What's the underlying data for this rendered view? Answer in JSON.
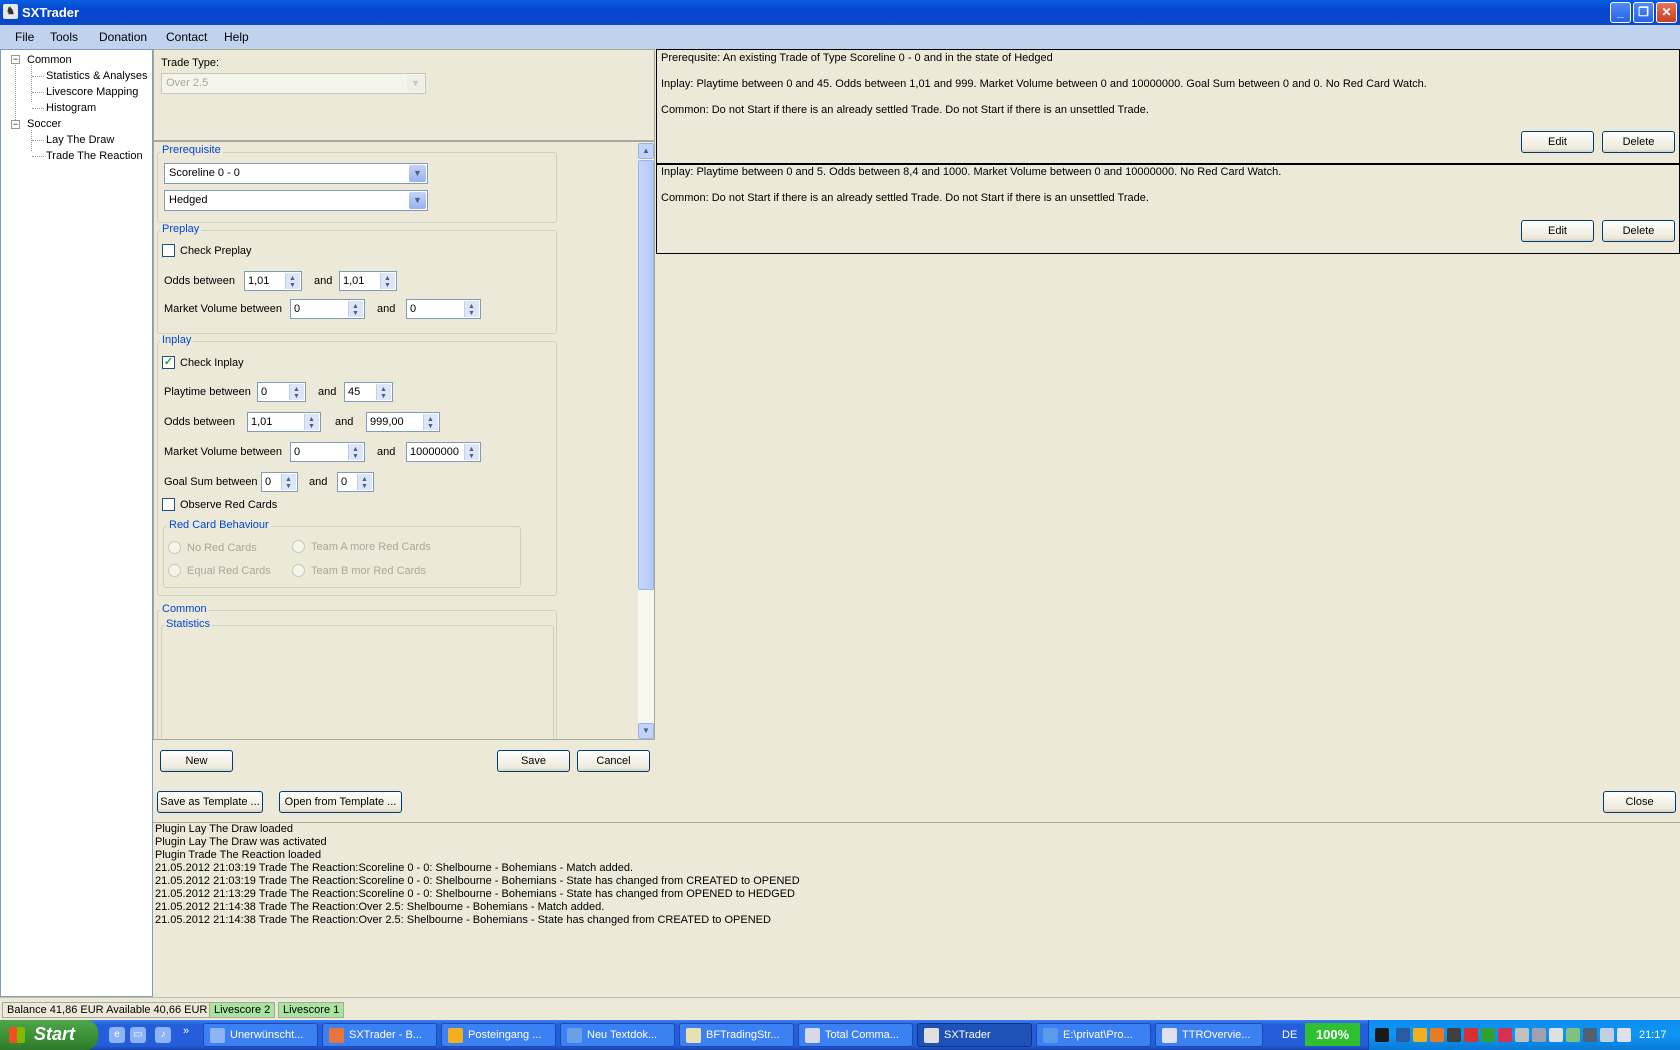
{
  "window": {
    "title": "SXTrader"
  },
  "menu": [
    "File",
    "Tools",
    "Donation",
    "Contact",
    "Help"
  ],
  "tree": {
    "groups": [
      {
        "label": "Common",
        "items": [
          "Statistics & Analyses",
          "Livescore Mapping",
          "Histogram"
        ]
      },
      {
        "label": "Soccer",
        "items": [
          "Lay The Draw",
          "Trade The Reaction"
        ]
      }
    ]
  },
  "form": {
    "trade_type_label": "Trade Type:",
    "trade_type_value": "Over 2.5",
    "prerequisite": {
      "title": "Prerequisite",
      "combo1": "Scoreline 0 - 0",
      "combo2": "Hedged"
    },
    "preplay": {
      "title": "Preplay",
      "check_label": "Check Preplay",
      "checked": false,
      "odds_label": "Odds between",
      "odds_from": "1,01",
      "odds_to": "1,01",
      "and_label": "and",
      "volume_label": "Market Volume between",
      "volume_from": "0",
      "volume_to": "0"
    },
    "inplay": {
      "title": "Inplay",
      "check_label": "Check Inplay",
      "checked": true,
      "playtime_label": "Playtime between",
      "playtime_from": "0",
      "playtime_to": "45",
      "odds_label": "Odds between",
      "odds_from": "1,01",
      "odds_to": "999,00",
      "volume_label": "Market Volume between",
      "volume_from": "0",
      "volume_to": "10000000",
      "goalsum_label": "Goal Sum between",
      "goalsum_from": "0",
      "goalsum_to": "0",
      "and_label": "and",
      "red_cards_label": "Observe Red Cards",
      "red_cards_checked": false,
      "red_card_behaviour": {
        "title": "Red Card Behaviour",
        "options": [
          "No Red Cards",
          "Team A more Red Cards",
          "Equal Red Cards",
          "Team B mor Red Cards"
        ]
      }
    },
    "common": {
      "title": "Common",
      "statistics_title": "Statistics"
    }
  },
  "buttons": {
    "new": "New",
    "save": "Save",
    "cancel": "Cancel",
    "save_template": "Save as Template ...",
    "open_template": "Open from Template ...",
    "close": "Close",
    "edit": "Edit",
    "delete": "Delete"
  },
  "cards": [
    {
      "lines": [
        "Prerequsite: An existing Trade of Type Scoreline 0 - 0 and in the state of Hedged",
        "Inplay: Playtime between 0 and 45. Odds between 1,01 and 999. Market Volume between 0 and 10000000. Goal Sum between 0 and 0. No Red Card Watch.",
        "Common: Do not Start if there is an already settled Trade. Do not Start if there is an unsettled Trade."
      ]
    },
    {
      "lines": [
        "Inplay: Playtime between 0 and 5. Odds between 8,4 and 1000. Market Volume between 0 and 10000000. No Red Card Watch.",
        "Common: Do not Start if there is an already settled Trade. Do not Start if there is an unsettled Trade."
      ]
    }
  ],
  "log": [
    "Plugin Lay The Draw loaded",
    "Plugin Lay The Draw was activated",
    "Plugin Trade The Reaction loaded",
    "21.05.2012 21:03:19 Trade The Reaction:Scoreline 0 - 0: Shelbourne - Bohemians - Match added.",
    "21.05.2012 21:03:19 Trade The Reaction:Scoreline 0 - 0: Shelbourne - Bohemians - State has changed from CREATED to OPENED",
    "21.05.2012 21:13:29 Trade The Reaction:Scoreline 0 - 0: Shelbourne - Bohemians - State has changed from OPENED to HEDGED",
    "21.05.2012 21:14:38 Trade The Reaction:Over  2.5: Shelbourne - Bohemians - Match added.",
    "21.05.2012 21:14:38 Trade The Reaction:Over  2.5: Shelbourne - Bohemians - State has changed from CREATED to OPENED"
  ],
  "status": {
    "balance": "Balance 41,86 EUR Available 40,66 EUR",
    "livescore2": "Livescore 2",
    "livescore1": "Livescore 1"
  },
  "taskbar": {
    "start": "Start",
    "items": [
      "Unerwünscht...",
      "SXTrader - B...",
      "Posteingang ...",
      "Neu Textdok...",
      "BFTradingStr...",
      "Total Comma...",
      "SXTrader",
      "E:\\privat\\Pro...",
      "TTROvervie..."
    ],
    "active_index": 6,
    "lang": "DE",
    "percent": "100%",
    "clock": "21:17"
  }
}
